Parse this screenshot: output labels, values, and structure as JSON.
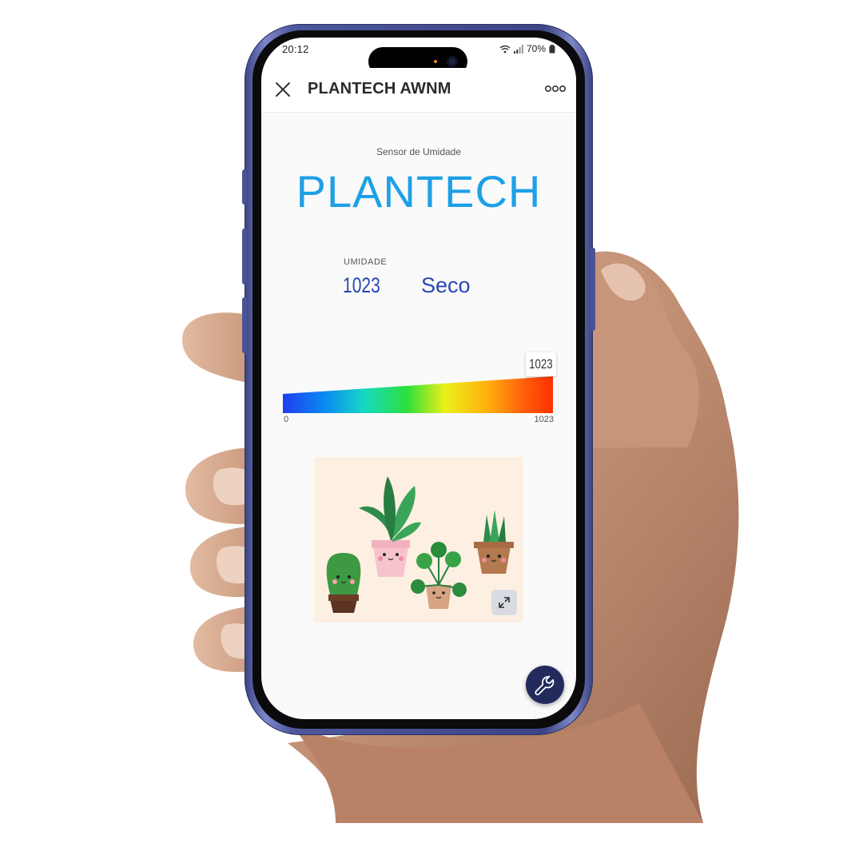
{
  "status_bar": {
    "time": "20:12",
    "battery": "70%"
  },
  "header": {
    "title": "PLANTECH AWNM"
  },
  "sensor": {
    "caption": "Sensor de Umidade",
    "brand": "PLANTECH",
    "humidity_label": "UMIDADE",
    "humidity_value": "1023",
    "humidity_state": "Seco"
  },
  "gauge": {
    "current_label": "1023",
    "min_label": "0",
    "max_label": "1023",
    "value": 1023,
    "min": 0,
    "max": 1023
  },
  "icons": {
    "close": "close-icon",
    "more": "more-icon",
    "expand": "expand-icon",
    "fab": "wrench-icon"
  },
  "colors": {
    "brand": "#1ea0e6",
    "value": "#2747b3",
    "fab": "#232a5c",
    "phone_frame": "#4d579c"
  }
}
